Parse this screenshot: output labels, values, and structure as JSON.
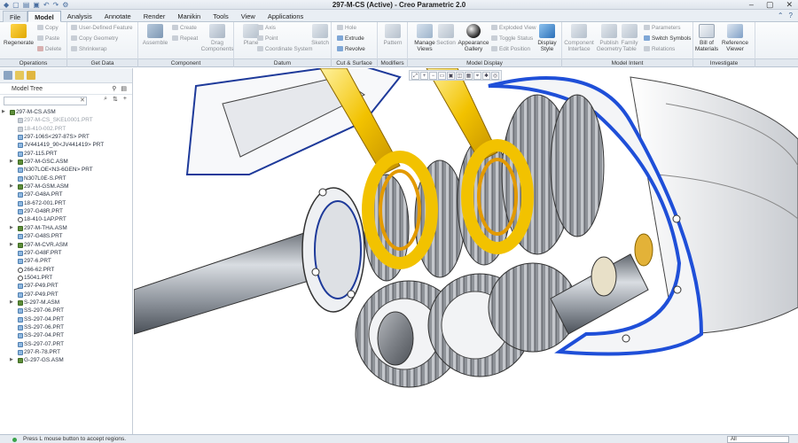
{
  "window": {
    "title": "297-M-CS (Active) - Creo Parametric 2.0"
  },
  "menu": {
    "tabs": [
      "File",
      "Model",
      "Analysis",
      "Annotate",
      "Render",
      "Manikin",
      "Tools",
      "View",
      "Applications"
    ],
    "active_tab": "Model"
  },
  "ribbon": {
    "operations": {
      "regenerate": "Regenerate",
      "copy": "Copy",
      "paste": "Paste",
      "delete": "Delete"
    },
    "get_data": {
      "user_defined_feature": "User-Defined Feature",
      "copy_geometry": "Copy Geometry",
      "shrinkwrap": "Shrinkwrap"
    },
    "component": {
      "assemble": "Assemble",
      "create": "Create",
      "repeat": "Repeat",
      "drag_components": "Drag Components"
    },
    "datum": {
      "plane": "Plane",
      "axis": "Axis",
      "point": "Point",
      "coordinate_system": "Coordinate System",
      "sketch": "Sketch"
    },
    "cut_surface": {
      "hole": "Hole",
      "extrude": "Extrude",
      "revolve": "Revolve"
    },
    "modifiers": {
      "pattern": "Pattern"
    },
    "model_display": {
      "manage_views": "Manage Views",
      "section": "Section",
      "appearance_gallery": "Appearance Gallery",
      "exploded_view": "Exploded View",
      "toggle_status": "Toggle Status",
      "edit_position": "Edit Position",
      "display_style": "Display Style"
    },
    "model_intent": {
      "component_interface": "Component Interface",
      "publish_geometry": "Publish Geometry",
      "family_table": "Family Table",
      "parameters": "Parameters",
      "switch_symbols": "Switch Symbols",
      "relations": "Relations"
    },
    "investigate": {
      "bill_of_materials": "Bill of Materials",
      "reference_viewer": "Reference Viewer"
    }
  },
  "group_labels": [
    "Operations",
    "Get Data",
    "Component",
    "Datum",
    "Cut & Surface",
    "Modifiers",
    "Model Display",
    "Model Intent",
    "Investigate"
  ],
  "model_tree": {
    "title": "Model Tree",
    "items": [
      {
        "label": "297-M-CS.ASM",
        "level": 0,
        "kind": "asm",
        "dim": false
      },
      {
        "label": "297-M-CS_SKEL0001.PRT",
        "level": 1,
        "kind": "prt",
        "dim": true
      },
      {
        "label": "18-410-002.PRT",
        "level": 1,
        "kind": "prt",
        "dim": true
      },
      {
        "label": "297-106S<297-87S> PRT",
        "level": 1,
        "kind": "prt",
        "dim": false
      },
      {
        "label": "JV441419_90<JV441419> PRT",
        "level": 1,
        "kind": "prt",
        "dim": false
      },
      {
        "label": "297-115.PRT",
        "level": 1,
        "kind": "prt",
        "dim": false
      },
      {
        "label": "297-M-GSC.ASM",
        "level": 1,
        "kind": "asm",
        "dim": false,
        "expandable": true
      },
      {
        "label": "N307LOE<N3-6GEN> PRT",
        "level": 1,
        "kind": "prt",
        "dim": false
      },
      {
        "label": "N307L0E-S.PRT",
        "level": 1,
        "kind": "prt",
        "dim": false
      },
      {
        "label": "297-M-GSM.ASM",
        "level": 1,
        "kind": "asm",
        "dim": false,
        "expandable": true
      },
      {
        "label": "297-G48A.PRT",
        "level": 1,
        "kind": "prt",
        "dim": false
      },
      {
        "label": "18-672-001.PRT",
        "level": 1,
        "kind": "prt",
        "dim": false
      },
      {
        "label": "297-G48R.PRT",
        "level": 1,
        "kind": "prt",
        "dim": false
      },
      {
        "label": "18-410-1AP.PRT",
        "level": 1,
        "kind": "cut",
        "dim": false
      },
      {
        "label": "297-M-THA.ASM",
        "level": 1,
        "kind": "asm",
        "dim": false,
        "expandable": true
      },
      {
        "label": "297-G48S.PRT",
        "level": 1,
        "kind": "prt",
        "dim": false
      },
      {
        "label": "297-M-CVR.ASM",
        "level": 1,
        "kind": "asm",
        "dim": false,
        "expandable": true
      },
      {
        "label": "297-G48F.PRT",
        "level": 1,
        "kind": "prt",
        "dim": false
      },
      {
        "label": "297-6.PRT",
        "level": 1,
        "kind": "prt",
        "dim": false
      },
      {
        "label": "266-62.PRT",
        "level": 1,
        "kind": "cut",
        "dim": false
      },
      {
        "label": "15041.PRT",
        "level": 1,
        "kind": "cut",
        "dim": false
      },
      {
        "label": "297-P49.PRT",
        "level": 1,
        "kind": "prt",
        "dim": false
      },
      {
        "label": "297-P49.PRT",
        "level": 1,
        "kind": "prt",
        "dim": false
      },
      {
        "label": "S-297-M.ASM",
        "level": 1,
        "kind": "asm",
        "dim": false,
        "expandable": true
      },
      {
        "label": "SS-297-06.PRT",
        "level": 1,
        "kind": "prt",
        "dim": false
      },
      {
        "label": "SS-297-04.PRT",
        "level": 1,
        "kind": "prt",
        "dim": false
      },
      {
        "label": "SS-297-06.PRT",
        "level": 1,
        "kind": "prt",
        "dim": false
      },
      {
        "label": "SS-297-04.PRT",
        "level": 1,
        "kind": "prt",
        "dim": false
      },
      {
        "label": "SS-297-07.PRT",
        "level": 1,
        "kind": "prt",
        "dim": false
      },
      {
        "label": "297-R-78.PRT",
        "level": 1,
        "kind": "prt",
        "dim": false
      },
      {
        "label": "G-297-GS.ASM",
        "level": 1,
        "kind": "asm",
        "dim": false,
        "expandable": true
      }
    ]
  },
  "status": {
    "message": "Press L mouse button to accept regions.",
    "filter_value": "All"
  },
  "colors": {
    "connecting_rod": "#f2c200",
    "gear": "#8b8d91",
    "cover_edge": "#1f4fd8",
    "shaft": "#9aa0a8",
    "assembly_icon": "#5e8e3a",
    "part_icon": "#8fb8e0"
  }
}
